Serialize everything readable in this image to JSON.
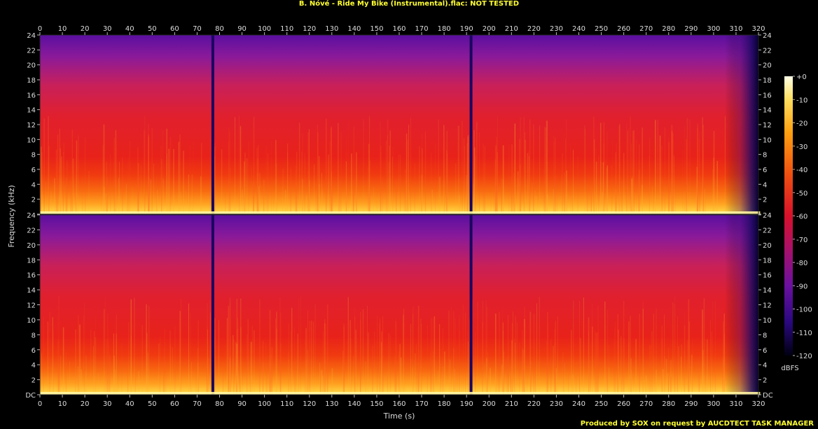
{
  "chart_data": {
    "type": "heatmap",
    "title": "B. Nóvé - Ride My Bike (Instrumental).flac: NOT TESTED",
    "xlabel": "Time (s)",
    "ylabel": "Frequency (kHz)",
    "xlim": [
      0,
      320
    ],
    "ylim": [
      0,
      24
    ],
    "x_ticks": [
      0,
      10,
      20,
      30,
      40,
      50,
      60,
      70,
      80,
      90,
      100,
      110,
      120,
      130,
      140,
      150,
      160,
      170,
      180,
      190,
      200,
      210,
      220,
      230,
      240,
      250,
      260,
      270,
      280,
      290,
      300,
      310,
      320
    ],
    "y_tick_values": [
      0,
      2,
      4,
      6,
      8,
      10,
      12,
      14,
      16,
      18,
      20,
      22,
      24
    ],
    "y_tick_labels": [
      "DC",
      "2",
      "4",
      "6",
      "8",
      "10",
      "12",
      "14",
      "16",
      "18",
      "20",
      "22",
      "24"
    ],
    "channels": 2,
    "colorbar": {
      "label": "dBFS",
      "range": [
        -120,
        0
      ],
      "ticks": [
        0,
        -10,
        -20,
        -30,
        -40,
        -50,
        -60,
        -70,
        -80,
        -90,
        -100,
        -110,
        -120
      ],
      "tick_labels": [
        "+0",
        "-10",
        "-20",
        "-30",
        "-40",
        "-50",
        "-60",
        "-70",
        "-80",
        "-90",
        "-100",
        "-110",
        "-120"
      ]
    },
    "dropouts_s": [
      77,
      192
    ],
    "fade_out_start_s": 305,
    "end_s": 322
  },
  "footer": "Produced by SOX on request by AUCDTECT TASK MANAGER",
  "colors": {
    "background": "#000000",
    "title": "#ffff33",
    "axis_text": "#dddddd",
    "tick": "#bbbbbb"
  }
}
